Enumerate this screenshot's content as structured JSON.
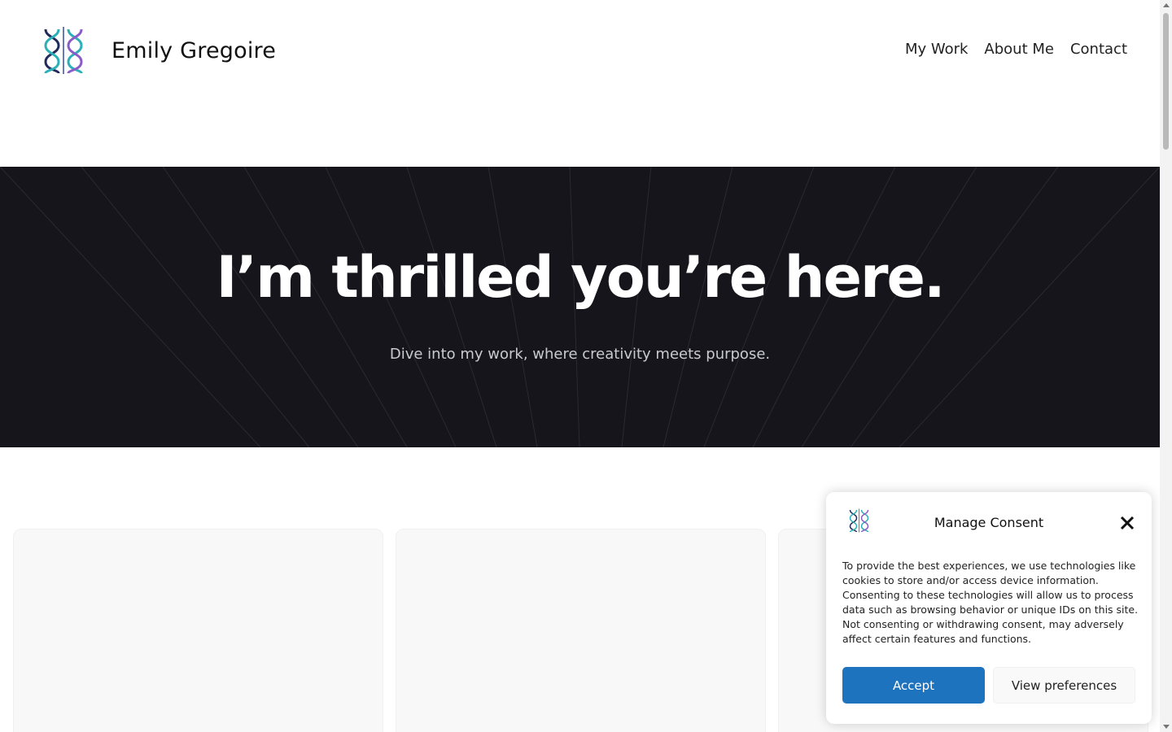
{
  "site": {
    "name": "Emily Gregoire",
    "logo_icon": "dna-helix-logo"
  },
  "nav": {
    "items": [
      {
        "label": "My Work"
      },
      {
        "label": "About Me"
      },
      {
        "label": "Contact"
      }
    ]
  },
  "hero": {
    "title": "I’m thrilled you’re here.",
    "subtitle": "Dive into my work, where creativity meets purpose."
  },
  "consent": {
    "title": "Manage Consent",
    "body": "To provide the best experiences, we use technologies like cookies to store and/or access device information. Consenting to these technologies will allow us to process data such as browsing behavior or unique IDs on this site. Not consenting or withdrawing consent, may adversely affect certain features and functions.",
    "accept_label": "Accept",
    "preferences_label": "View preferences",
    "close_icon": "close-icon"
  },
  "colors": {
    "hero_bg": "#15151b",
    "accent": "#1e73be",
    "logo_dark": "#232a5c",
    "logo_teal": "#2bb0b8",
    "logo_violet": "#8b5cc8"
  }
}
